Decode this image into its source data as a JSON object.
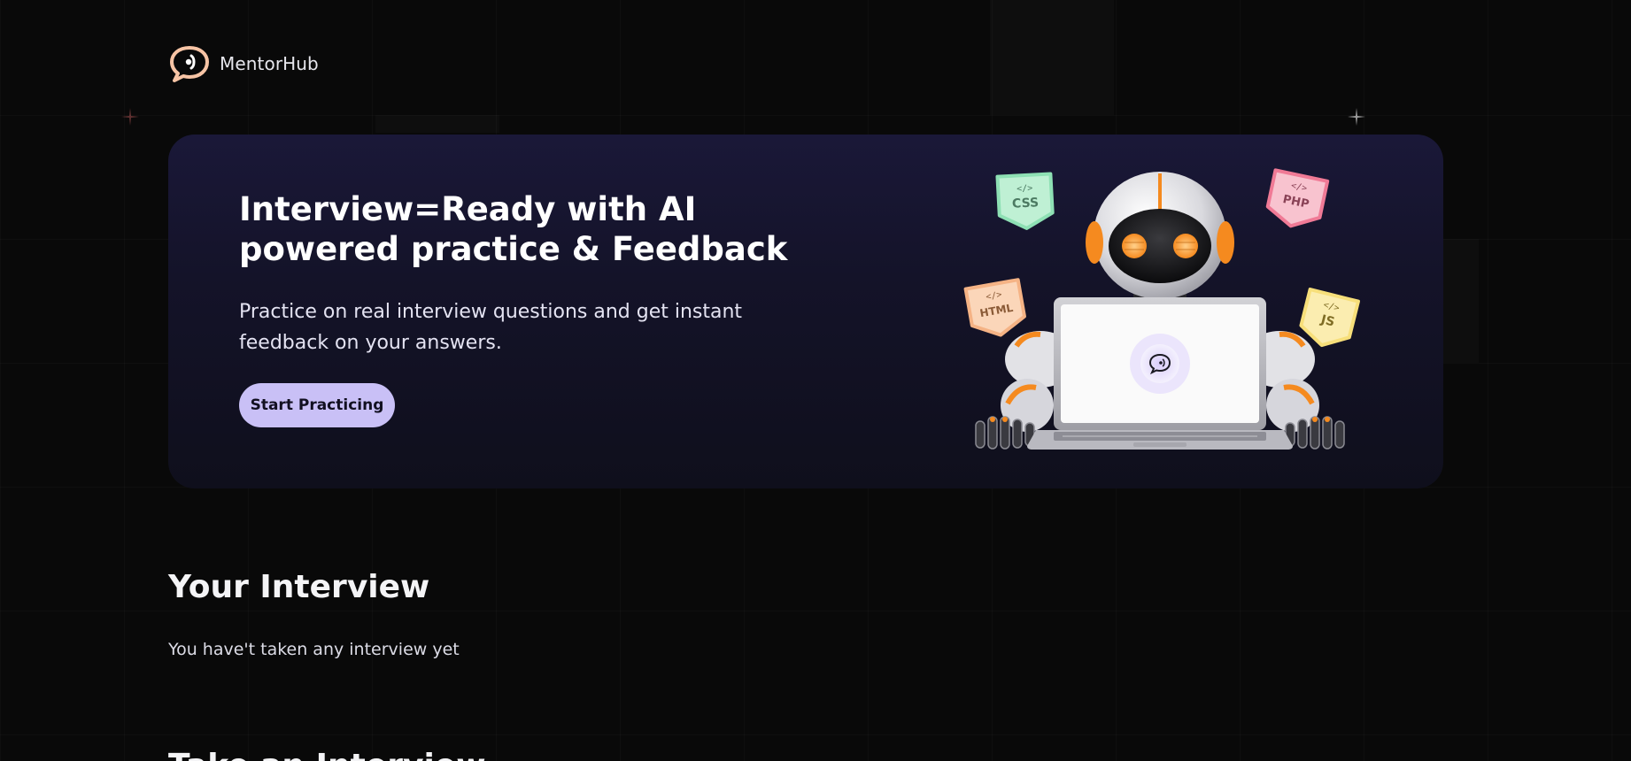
{
  "header": {
    "logo_icon": "chat-bubble-sound-icon",
    "brand_name": "MentorHub"
  },
  "hero": {
    "title": "Interview=Ready with AI powered practice & Feedback",
    "subtitle": "Practice on real interview questions and get instant feedback on your answers.",
    "cta_label": "Start Practicing",
    "illustration": {
      "badges": [
        "CSS",
        "PHP",
        "HTML",
        "JS"
      ],
      "badge_symbol": "</>"
    }
  },
  "interviews": {
    "title": "Your Interview",
    "empty_message": "You have't taken any interview yet"
  },
  "next_section": {
    "title": "Take an Interview"
  },
  "colors": {
    "background": "#090909",
    "hero_gradient_top": "#1a1838",
    "hero_gradient_bottom": "#0f0f1c",
    "cta_background": "#c9c0f6",
    "cta_text": "#121021",
    "logo_accent": "#f7c4a5",
    "css_badge": "#8ee0b4",
    "php_badge": "#f07a96",
    "html_badge": "#f5b385",
    "js_badge": "#f7df7a",
    "robot_eye": "#f58a1f"
  }
}
